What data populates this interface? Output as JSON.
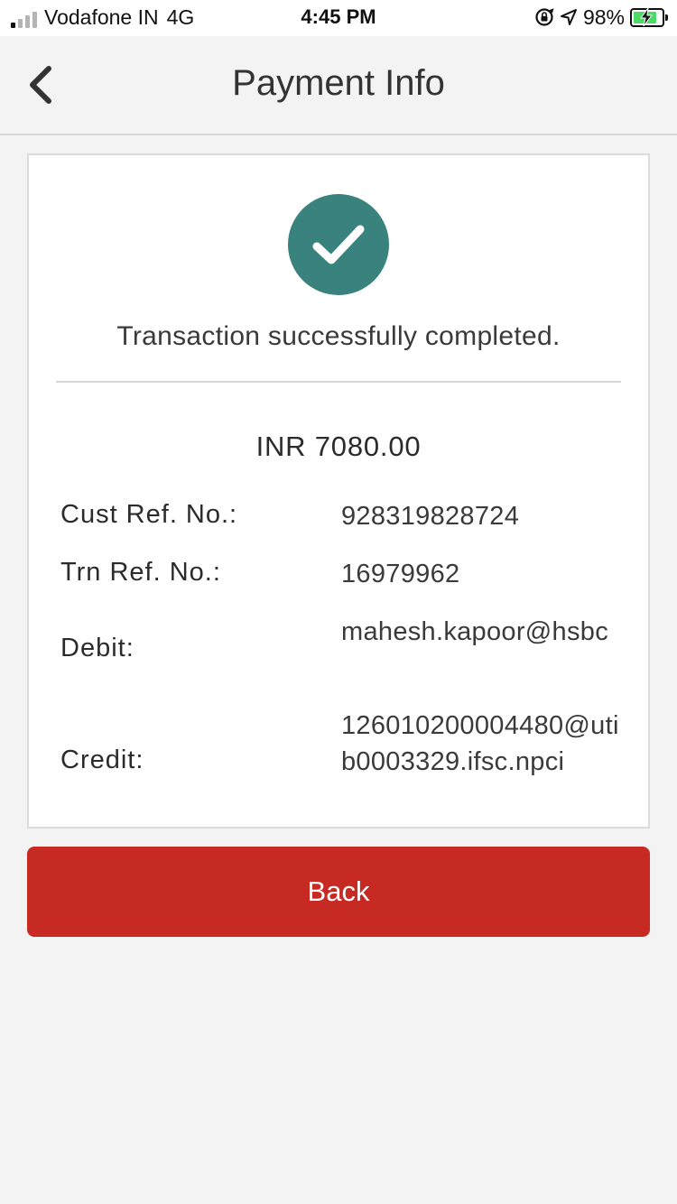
{
  "status_bar": {
    "carrier": "Vodafone IN",
    "network": "4G",
    "time": "4:45 PM",
    "battery_percent": "98%",
    "battery_level": 0.98,
    "signal_bars_total": 4,
    "signal_bars_active": 1,
    "icons": [
      "orientation-lock-icon",
      "location-arrow-icon",
      "battery-charging-icon"
    ]
  },
  "header": {
    "title": "Payment Info",
    "back_icon": "chevron-left-icon"
  },
  "receipt": {
    "status_icon": "check-circle-icon",
    "status_color": "#3a827d",
    "message": "Transaction successfully completed.",
    "amount": "INR 7080.00",
    "rows": [
      {
        "label": "Cust Ref. No.:",
        "value": "928319828724"
      },
      {
        "label": "Trn Ref. No.:",
        "value": "16979962"
      },
      {
        "label": "Debit:",
        "value": "mahesh.kapoor@hsbc"
      },
      {
        "label": "Credit:",
        "value": "126010200004480@utib0003329.ifsc.npci"
      }
    ]
  },
  "actions": {
    "back_label": "Back",
    "back_color": "#c62a23"
  }
}
